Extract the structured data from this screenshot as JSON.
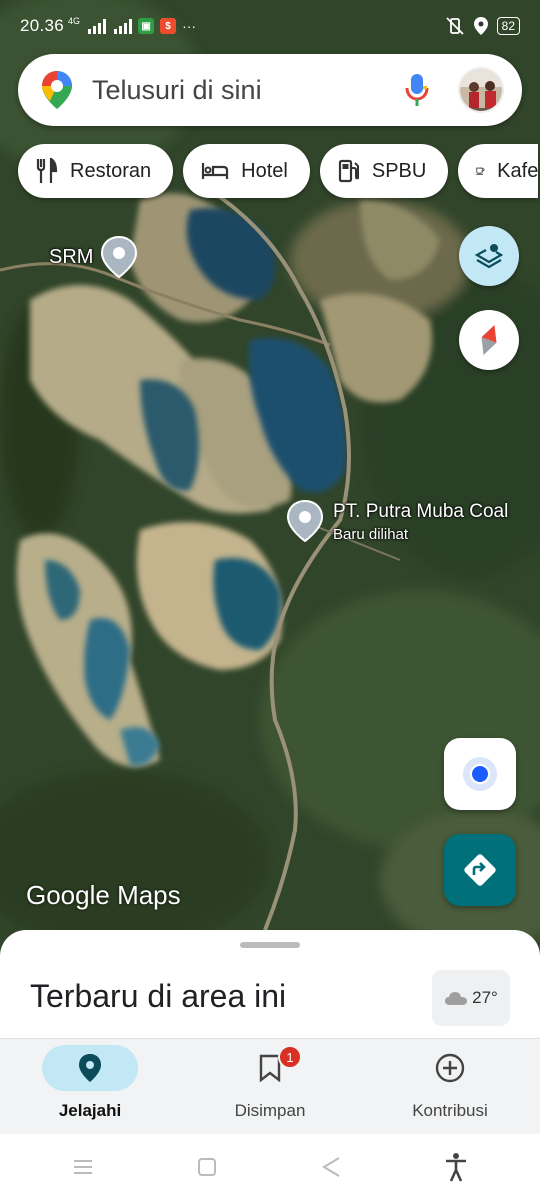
{
  "status_bar": {
    "time": "20.36",
    "network_tag": "4G",
    "battery": "82"
  },
  "search": {
    "placeholder": "Telusuri di sini"
  },
  "chips": [
    {
      "label": "Restoran",
      "icon": "restaurant-icon"
    },
    {
      "label": "Hotel",
      "icon": "hotel-icon"
    },
    {
      "label": "SPBU",
      "icon": "gas-station-icon"
    },
    {
      "label": "Kafe",
      "icon": "cafe-icon"
    }
  ],
  "map": {
    "places": [
      {
        "name": "SRM",
        "subtitle": ""
      },
      {
        "name": "PT. Putra Muba Coal",
        "subtitle": "Baru dilihat"
      }
    ],
    "brand": "Google Maps"
  },
  "sheet": {
    "title": "Terbaru di area ini",
    "weather": "27°"
  },
  "bottom_nav": [
    {
      "label": "Jelajahi",
      "icon": "explore-pin-icon",
      "active": true
    },
    {
      "label": "Disimpan",
      "icon": "bookmark-icon",
      "badge": "1"
    },
    {
      "label": "Kontribusi",
      "icon": "add-circle-icon"
    }
  ],
  "colors": {
    "accent": "#c2e7f5",
    "directions": "#00707a",
    "badge": "#d93025",
    "location_dot": "#1a5cff"
  }
}
